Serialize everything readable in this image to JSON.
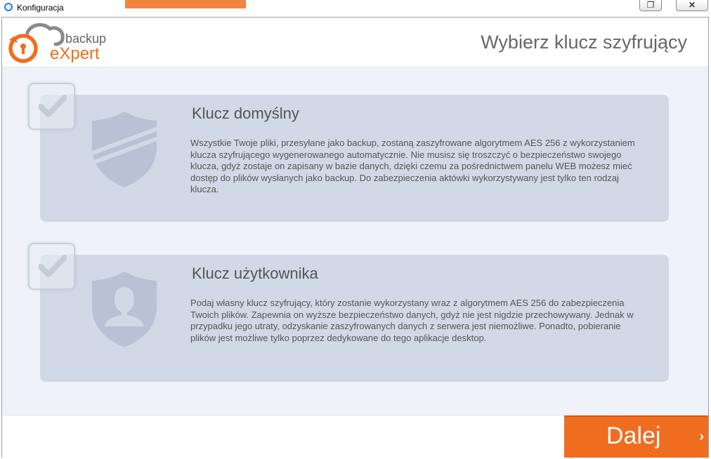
{
  "window": {
    "title": "Konfiguracja",
    "restore_glyph": "❐",
    "close_glyph": "✕"
  },
  "brand": {
    "line1": "backup",
    "line2": "eXpert",
    "accent": "#f06d1f"
  },
  "header": {
    "title": "Wybierz klucz szyfrujący"
  },
  "options": [
    {
      "title": "Klucz domyślny",
      "description": "Wszystkie Twoje pliki, przesyłane jako backup, zostaną zaszyfrowane algorytmem AES 256 z wykorzystaniem klucza szyfrującego wygenerowanego automatycznie. Nie musisz się troszczyć o bezpieczeństwo swojego klucza, gdyż zostaje on zapisany w bazie danych, dzięki czemu za pośrednictwem panelu WEB możesz mieć dostęp do plików wysłanych jako backup. Do zabezpieczenia aktówki wykorzystywany jest tylko ten rodzaj klucza.",
      "icon": "shield-icon"
    },
    {
      "title": "Klucz użytkownika",
      "description": "Podaj własny klucz szyfrujący, który zostanie wykorzystany wraz z algorytmem AES 256 do zabezpieczenia Twoich plików. Zapewnia on wyższe bezpieczeństwo danych, gdyż nie jest nigdzie przechowywany. Jednak w przypadku jego utraty, odzyskanie zaszyfrowanych danych z serwera jest niemożliwe. Ponadto, pobieranie plików jest możliwe tylko poprzez dedykowane do tego aplikacje desktop.",
      "icon": "user-shield-icon"
    }
  ],
  "footer": {
    "next_label": "Dalej",
    "next_chevron": "›"
  }
}
